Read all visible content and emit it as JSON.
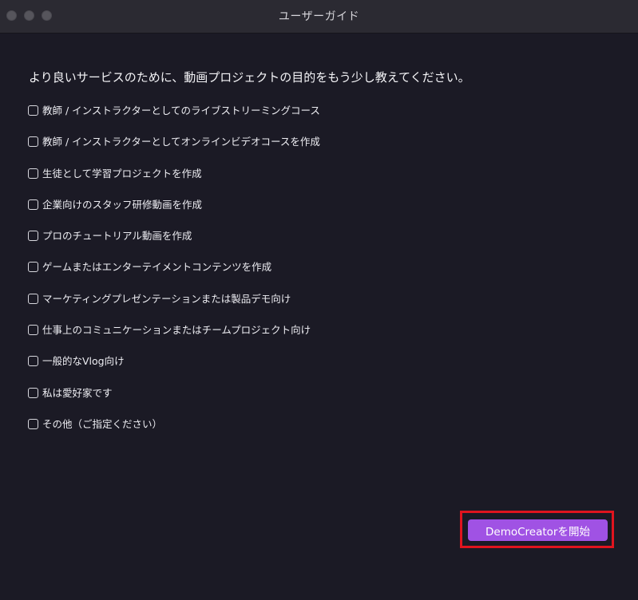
{
  "window": {
    "title": "ユーザーガイド"
  },
  "survey": {
    "question": "より良いサービスのために、動画プロジェクトの目的をもう少し教えてください。",
    "options": [
      {
        "label": "教師 / インストラクターとしてのライブストリーミングコース",
        "checked": false
      },
      {
        "label": "教師 / インストラクターとしてオンラインビデオコースを作成",
        "checked": false
      },
      {
        "label": "生徒として学習プロジェクトを作成",
        "checked": false
      },
      {
        "label": "企業向けのスタッフ研修動画を作成",
        "checked": false
      },
      {
        "label": "プロのチュートリアル動画を作成",
        "checked": false
      },
      {
        "label": "ゲームまたはエンターテイメントコンテンツを作成",
        "checked": false
      },
      {
        "label": "マーケティングプレゼンテーションまたは製品デモ向け",
        "checked": false
      },
      {
        "label": "仕事上のコミュニケーションまたはチームプロジェクト向け",
        "checked": false
      },
      {
        "label": "一般的なVlog向け",
        "checked": false
      },
      {
        "label": "私は愛好家です",
        "checked": false
      },
      {
        "label": "その他（ご指定ください）",
        "checked": false
      }
    ]
  },
  "footer": {
    "start_button_label": "DemoCreatorを開始"
  },
  "colors": {
    "background": "#1b1a25",
    "titlebar": "#2b2a32",
    "accent": "#a052e4",
    "highlight_border": "#e0141e"
  }
}
